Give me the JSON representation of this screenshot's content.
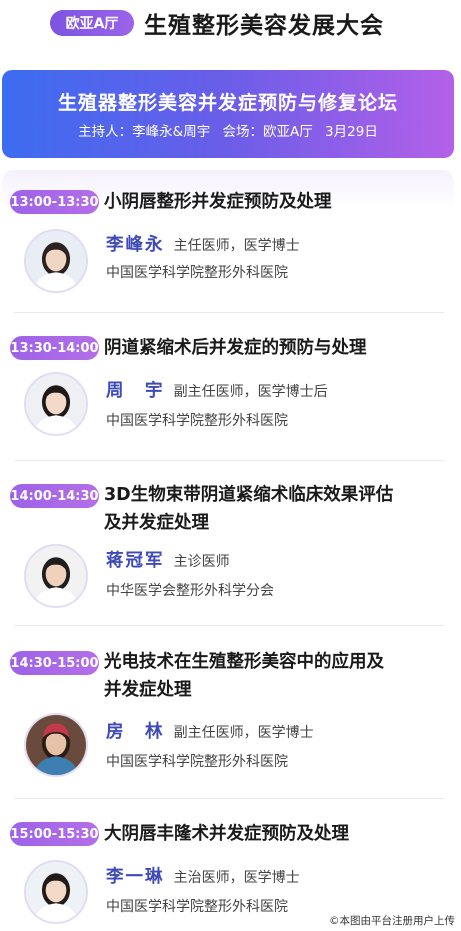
{
  "header": {
    "hall": "欧亚A厅",
    "title": "生殖整形美容发展大会"
  },
  "forum": {
    "title": "生殖器整形美容并发症预防与修复论坛",
    "host": "主持人：李峰永&周宇",
    "venue": "会场：欧亚A厅",
    "date": "3月29日"
  },
  "sessions": [
    {
      "time": "13:00-13:30",
      "title_lines": [
        "小阴唇整形并发症预防及处理"
      ],
      "speaker": "李峰永",
      "role": "主任医师，医学博士",
      "affiliation": "中国医学科学院整形外科医院",
      "avatar": {
        "bg": "#e9eef4",
        "hair": "#2b2220",
        "skin": "#f1d6c4",
        "coat": "#ffffff",
        "cap": ""
      }
    },
    {
      "time": "13:30-14:00",
      "title_lines": [
        "阴道紧缩术后并发症的预防与处理"
      ],
      "speaker": "周　宇",
      "role": "副主任医师，医学博士后",
      "affiliation": "中国医学科学院整形外科医院",
      "avatar": {
        "bg": "#eef0f3",
        "hair": "#1f1a18",
        "skin": "#f3d9c8",
        "coat": "#ffffff",
        "cap": ""
      }
    },
    {
      "time": "14:00-14:30",
      "title_lines": [
        "3D生物束带阴道紧缩术临床效果评估",
        "及并发症处理"
      ],
      "speaker": "蒋冠军",
      "role": "主诊医师",
      "affiliation": "中华医学会整形外科学分会",
      "avatar": {
        "bg": "#f2f2f2",
        "hair": "#1e1e1e",
        "skin": "#f0d2bc",
        "coat": "#ffffff",
        "cap": ""
      }
    },
    {
      "time": "14:30-15:00",
      "title_lines": [
        "光电技术在生殖整形美容中的应用及",
        "并发症处理"
      ],
      "speaker": "房　林",
      "role": "副主任医师，医学博士",
      "affiliation": "中国医学科学院整形外科医院",
      "avatar": {
        "bg": "#6a4a3c",
        "hair": "#2a1c16",
        "skin": "#e8c2a8",
        "coat": "#3d7fb0",
        "cap": "#c23a4a"
      }
    },
    {
      "time": "15:00-15:30",
      "title_lines": [
        "大阴唇丰隆术并发症预防及处理"
      ],
      "speaker": "李一琳",
      "role": "主治医师，医学博士",
      "affiliation": "中国医学科学院整形外科医院",
      "avatar": {
        "bg": "#eef1f5",
        "hair": "#231b18",
        "skin": "#f2d8c6",
        "coat": "#ffffff",
        "cap": ""
      }
    }
  ],
  "watermark": "©本图由平台注册用户上传"
}
